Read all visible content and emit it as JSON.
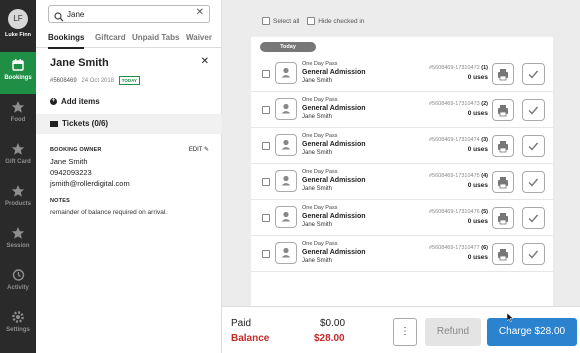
{
  "user": {
    "initials": "LF",
    "name": "Luke Finn"
  },
  "nav": [
    {
      "label": "Bookings",
      "icon": "calendar-icon",
      "active": true
    },
    {
      "label": "Food",
      "icon": "star-icon"
    },
    {
      "label": "Gift Card",
      "icon": "star-icon"
    },
    {
      "label": "Products",
      "icon": "star-icon"
    },
    {
      "label": "Session",
      "icon": "star-icon"
    },
    {
      "label": "Activity",
      "icon": "history-icon"
    },
    {
      "label": "Settings",
      "icon": "gear-icon"
    }
  ],
  "search": {
    "value": "Jane",
    "placeholder": "Search"
  },
  "tabs": [
    "Bookings",
    "Giftcard",
    "Unpaid Tabs",
    "Waiver"
  ],
  "booking": {
    "name": "Jane Smith",
    "id": "#5608469",
    "date": "24 Oct 2018",
    "badge": "TODAY",
    "add_items": "Add items",
    "tickets": "Tickets (0/6)",
    "owner_label": "BOOKING OWNER",
    "edit_label": "EDIT",
    "owner_name": "Jane Smith",
    "owner_phone": "0942093223",
    "owner_email": "jsmith@rollerdigital.com",
    "notes_label": "NOTES",
    "notes": "remainder of balance required on arrival."
  },
  "select_all": "Select all",
  "hide_checked": "Hide checked in",
  "today_label": "Today",
  "tickets": [
    {
      "type": "One Day Pass",
      "title": "General Admission",
      "holder": "Jane Smith",
      "id": "#5608469-17310472",
      "num": "(1)",
      "uses": "0 uses"
    },
    {
      "type": "One Day Pass",
      "title": "General Admission",
      "holder": "Jane Smith",
      "id": "#5608469-17310473",
      "num": "(2)",
      "uses": "0 uses"
    },
    {
      "type": "One Day Pass",
      "title": "General Admission",
      "holder": "Jane Smith",
      "id": "#5608469-17310474",
      "num": "(3)",
      "uses": "0 uses"
    },
    {
      "type": "One Day Pass",
      "title": "General Admission",
      "holder": "Jane Smith",
      "id": "#5608469-17310475",
      "num": "(4)",
      "uses": "0 uses"
    },
    {
      "type": "One Day Pass",
      "title": "General Admission",
      "holder": "Jane Smith",
      "id": "#5608469-17310476",
      "num": "(5)",
      "uses": "0 uses"
    },
    {
      "type": "One Day Pass",
      "title": "General Admission",
      "holder": "Jane Smith",
      "id": "#5608469-17310477",
      "num": "(6)",
      "uses": "0 uses"
    }
  ],
  "footer": {
    "paid_label": "Paid",
    "paid_value": "$0.00",
    "balance_label": "Balance",
    "balance_value": "$28.00",
    "more": "⋮",
    "refund": "Refund",
    "charge": "Charge $28.00"
  },
  "colors": {
    "accent": "#1f8f45",
    "primary": "#2b83d0",
    "danger": "#c42b2b"
  }
}
